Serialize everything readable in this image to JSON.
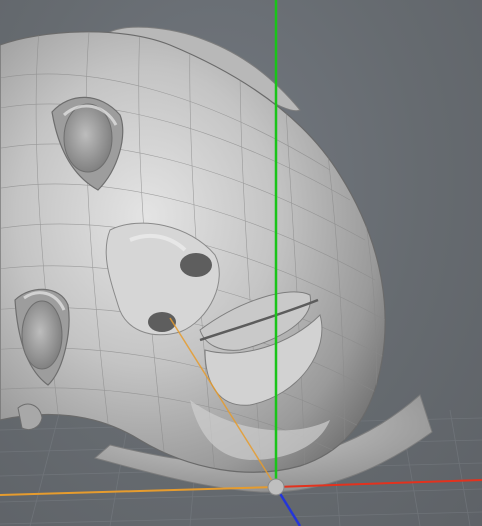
{
  "viewport": {
    "background_color": "#666b70",
    "grid_color": "#7a7f85",
    "model_shade_light": "#d9d9d9",
    "model_shade_dark": "#6e6e6e",
    "wire_color": "#8a8a8a"
  },
  "axes": {
    "y_axis_color": "#19c419",
    "x_axis_color": "#e2321e",
    "z_axis_color": "#e69c2e",
    "neg_axis_color": "#2436d8",
    "origin_pivot_color": "#bfbfbf"
  },
  "icons": {
    "pivot": "origin-pivot-icon"
  }
}
